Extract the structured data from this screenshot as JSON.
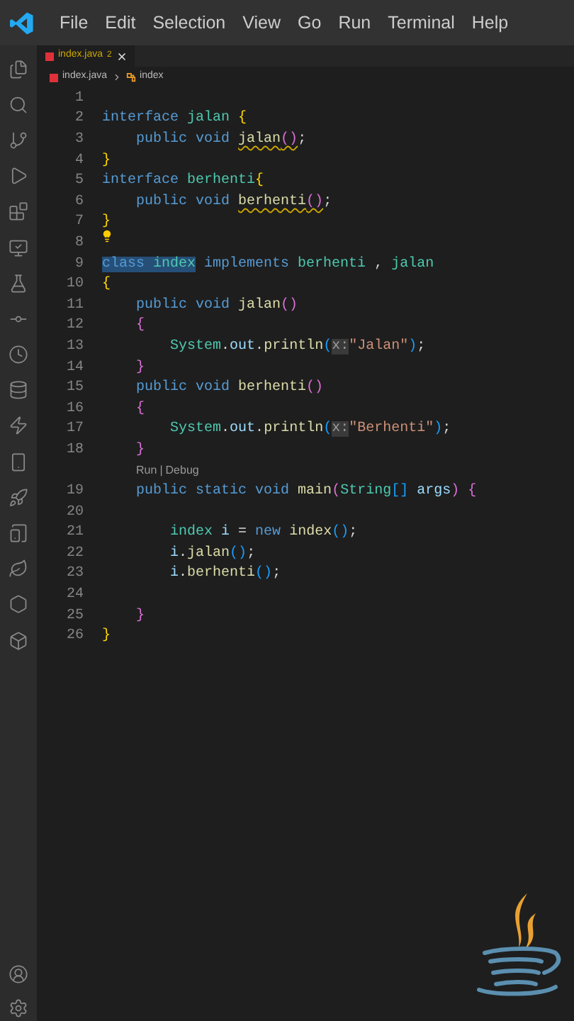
{
  "menu": [
    "File",
    "Edit",
    "Selection",
    "View",
    "Go",
    "Run",
    "Terminal",
    "Help"
  ],
  "tab": {
    "label": "index.java",
    "problems": "2",
    "selected": true
  },
  "breadcrumb": [
    "index.java",
    "index"
  ],
  "lines": [
    {
      "kind": "code",
      "number": "1",
      "lightbulb": false
    },
    {
      "kind": "code",
      "number": "2",
      "lightbulb": false,
      "tokens": [
        {
          "text": "interface",
          "kind": "kw",
          "selected": false,
          "warning": false
        },
        {
          "text": " jalan",
          "kind": "type",
          "selected": false,
          "warning": false
        },
        {
          "text": " {",
          "kind": "b1",
          "selected": false,
          "warning": false
        }
      ]
    },
    {
      "kind": "code",
      "number": "3",
      "lightbulb": false,
      "tokens": [
        {
          "text": "    public",
          "kind": "kw",
          "selected": false,
          "warning": false
        },
        {
          "text": " void ",
          "kind": "kw",
          "selected": false,
          "warning": false
        },
        {
          "text": "jalan",
          "kind": "fn",
          "selected": false,
          "warning": true
        },
        {
          "text": "()",
          "kind": "b2",
          "selected": false,
          "warning": true
        },
        {
          "text": ";",
          "kind": "punc",
          "selected": false,
          "warning": false
        }
      ]
    },
    {
      "kind": "code",
      "number": "4",
      "lightbulb": false,
      "tokens": [
        {
          "text": "}",
          "kind": "b1",
          "selected": false,
          "warning": false
        }
      ]
    },
    {
      "kind": "code",
      "number": "5",
      "lightbulb": false,
      "tokens": [
        {
          "text": "interface",
          "kind": "kw",
          "selected": false,
          "warning": false
        },
        {
          "text": " berhenti",
          "kind": "type",
          "selected": false,
          "warning": false
        },
        {
          "text": "{",
          "kind": "b1",
          "selected": false,
          "warning": false
        }
      ]
    },
    {
      "kind": "code",
      "number": "6",
      "lightbulb": false,
      "tokens": [
        {
          "text": "    public",
          "kind": "kw",
          "selected": false,
          "warning": false
        },
        {
          "text": " void ",
          "kind": "kw",
          "selected": false,
          "warning": false
        },
        {
          "text": "berhenti",
          "kind": "fn",
          "selected": false,
          "warning": true
        },
        {
          "text": "()",
          "kind": "b2",
          "selected": false,
          "warning": true
        },
        {
          "text": ";",
          "kind": "punc",
          "selected": false,
          "warning": false
        }
      ]
    },
    {
      "kind": "code",
      "number": "7",
      "lightbulb": false,
      "tokens": [
        {
          "text": "}",
          "kind": "b1",
          "selected": false,
          "warning": false
        }
      ]
    },
    {
      "kind": "code",
      "number": "8",
      "lightbulb": true
    },
    {
      "kind": "code",
      "number": "9",
      "lightbulb": false,
      "tokens": [
        {
          "text": "class",
          "kind": "kw",
          "selected": true,
          "warning": false
        },
        {
          "text": " index",
          "kind": "type",
          "selected": true,
          "warning": false
        },
        {
          "text": " implements",
          "kind": "kw",
          "selected": false,
          "warning": false
        },
        {
          "text": " berhenti",
          "kind": "type",
          "selected": false,
          "warning": false
        },
        {
          "text": " ,",
          "kind": "punc",
          "selected": false,
          "warning": false
        },
        {
          "text": " jalan",
          "kind": "type",
          "selected": false,
          "warning": false
        }
      ]
    },
    {
      "kind": "code",
      "number": "10",
      "lightbulb": false,
      "tokens": [
        {
          "text": "{",
          "kind": "b1",
          "selected": false,
          "warning": false
        }
      ]
    },
    {
      "kind": "code",
      "number": "11",
      "lightbulb": false,
      "tokens": [
        {
          "text": "    public",
          "kind": "kw",
          "selected": false,
          "warning": false
        },
        {
          "text": " void",
          "kind": "kw",
          "selected": false,
          "warning": false
        },
        {
          "text": " jalan",
          "kind": "fn",
          "selected": false,
          "warning": false
        },
        {
          "text": "()",
          "kind": "b2",
          "selected": false,
          "warning": false
        }
      ]
    },
    {
      "kind": "code",
      "number": "12",
      "lightbulb": false,
      "tokens": [
        {
          "text": "    {",
          "kind": "b2",
          "selected": false,
          "warning": false
        }
      ]
    },
    {
      "kind": "code",
      "number": "13",
      "lightbulb": false,
      "tokens": [
        {
          "text": "        System",
          "kind": "type",
          "selected": false,
          "warning": false
        },
        {
          "text": ".",
          "kind": "punc",
          "selected": false,
          "warning": false
        },
        {
          "text": "out",
          "kind": "var",
          "selected": false,
          "warning": false
        },
        {
          "text": ".",
          "kind": "punc",
          "selected": false,
          "warning": false
        },
        {
          "text": "println",
          "kind": "fn",
          "selected": false,
          "warning": false
        },
        {
          "text": "(",
          "kind": "b3",
          "selected": false,
          "warning": false
        },
        {
          "text": "x:",
          "kind": "hint",
          "selected": false,
          "warning": false
        },
        {
          "text": "\"Jalan\"",
          "kind": "str",
          "selected": false,
          "warning": false
        },
        {
          "text": ")",
          "kind": "b3",
          "selected": false,
          "warning": false
        },
        {
          "text": ";",
          "kind": "punc",
          "selected": false,
          "warning": false
        }
      ]
    },
    {
      "kind": "code",
      "number": "14",
      "lightbulb": false,
      "tokens": [
        {
          "text": "    }",
          "kind": "b2",
          "selected": false,
          "warning": false
        }
      ]
    },
    {
      "kind": "code",
      "number": "15",
      "lightbulb": false,
      "tokens": [
        {
          "text": "    public",
          "kind": "kw",
          "selected": false,
          "warning": false
        },
        {
          "text": " void",
          "kind": "kw",
          "selected": false,
          "warning": false
        },
        {
          "text": " berhenti",
          "kind": "fn",
          "selected": false,
          "warning": false
        },
        {
          "text": "()",
          "kind": "b2",
          "selected": false,
          "warning": false
        }
      ]
    },
    {
      "kind": "code",
      "number": "16",
      "lightbulb": false,
      "tokens": [
        {
          "text": "    {",
          "kind": "b2",
          "selected": false,
          "warning": false
        }
      ]
    },
    {
      "kind": "code",
      "number": "17",
      "lightbulb": false,
      "tokens": [
        {
          "text": "        System",
          "kind": "type",
          "selected": false,
          "warning": false
        },
        {
          "text": ".",
          "kind": "punc",
          "selected": false,
          "warning": false
        },
        {
          "text": "out",
          "kind": "var",
          "selected": false,
          "warning": false
        },
        {
          "text": ".",
          "kind": "punc",
          "selected": false,
          "warning": false
        },
        {
          "text": "println",
          "kind": "fn",
          "selected": false,
          "warning": false
        },
        {
          "text": "(",
          "kind": "b3",
          "selected": false,
          "warning": false
        },
        {
          "text": "x:",
          "kind": "hint",
          "selected": false,
          "warning": false
        },
        {
          "text": "\"Berhenti\"",
          "kind": "str",
          "selected": false,
          "warning": false
        },
        {
          "text": ")",
          "kind": "b3",
          "selected": false,
          "warning": false
        },
        {
          "text": ";",
          "kind": "punc",
          "selected": false,
          "warning": false
        }
      ]
    },
    {
      "kind": "code",
      "number": "18",
      "lightbulb": false,
      "tokens": [
        {
          "text": "    }",
          "kind": "b2",
          "selected": false,
          "warning": false
        }
      ]
    },
    {
      "kind": "codelens",
      "run": "Run",
      "separator": "|",
      "debug": "Debug"
    },
    {
      "kind": "code",
      "number": "19",
      "lightbulb": false,
      "tokens": [
        {
          "text": "    public",
          "kind": "kw",
          "selected": false,
          "warning": false
        },
        {
          "text": " static",
          "kind": "kw",
          "selected": false,
          "warning": false
        },
        {
          "text": " void",
          "kind": "kw",
          "selected": false,
          "warning": false
        },
        {
          "text": " main",
          "kind": "fn",
          "selected": false,
          "warning": false
        },
        {
          "text": "(",
          "kind": "b2",
          "selected": false,
          "warning": false
        },
        {
          "text": "String",
          "kind": "type",
          "selected": false,
          "warning": false
        },
        {
          "text": "[]",
          "kind": "b3",
          "selected": false,
          "warning": false
        },
        {
          "text": " args",
          "kind": "var",
          "selected": false,
          "warning": false
        },
        {
          "text": ")",
          "kind": "b2",
          "selected": false,
          "warning": false
        },
        {
          "text": " {",
          "kind": "b2",
          "selected": false,
          "warning": false
        }
      ]
    },
    {
      "kind": "code",
      "number": "20",
      "lightbulb": false
    },
    {
      "kind": "code",
      "number": "21",
      "lightbulb": false,
      "tokens": [
        {
          "text": "        index",
          "kind": "type",
          "selected": false,
          "warning": false
        },
        {
          "text": " i",
          "kind": "var",
          "selected": false,
          "warning": false
        },
        {
          "text": " =",
          "kind": "punc",
          "selected": false,
          "warning": false
        },
        {
          "text": " new",
          "kind": "kw",
          "selected": false,
          "warning": false
        },
        {
          "text": " index",
          "kind": "fn",
          "selected": false,
          "warning": false
        },
        {
          "text": "()",
          "kind": "b3",
          "selected": false,
          "warning": false
        },
        {
          "text": ";",
          "kind": "punc",
          "selected": false,
          "warning": false
        }
      ]
    },
    {
      "kind": "code",
      "number": "22",
      "lightbulb": false,
      "tokens": [
        {
          "text": "        i",
          "kind": "var",
          "selected": false,
          "warning": false
        },
        {
          "text": ".",
          "kind": "punc",
          "selected": false,
          "warning": false
        },
        {
          "text": "jalan",
          "kind": "fn",
          "selected": false,
          "warning": false
        },
        {
          "text": "()",
          "kind": "b3",
          "selected": false,
          "warning": false
        },
        {
          "text": ";",
          "kind": "punc",
          "selected": false,
          "warning": false
        }
      ]
    },
    {
      "kind": "code",
      "number": "23",
      "lightbulb": false,
      "tokens": [
        {
          "text": "        i",
          "kind": "var",
          "selected": false,
          "warning": false
        },
        {
          "text": ".",
          "kind": "punc",
          "selected": false,
          "warning": false
        },
        {
          "text": "berhenti",
          "kind": "fn",
          "selected": false,
          "warning": false
        },
        {
          "text": "()",
          "kind": "b3",
          "selected": false,
          "warning": false
        },
        {
          "text": ";",
          "kind": "punc",
          "selected": false,
          "warning": false
        }
      ]
    },
    {
      "kind": "code",
      "number": "24",
      "lightbulb": false
    },
    {
      "kind": "code",
      "number": "25",
      "lightbulb": false,
      "tokens": [
        {
          "text": "    }",
          "kind": "b2",
          "selected": false,
          "warning": false
        }
      ]
    },
    {
      "kind": "code",
      "number": "26",
      "lightbulb": false,
      "tokens": [
        {
          "text": "}",
          "kind": "b1",
          "selected": false,
          "warning": false
        }
      ]
    }
  ]
}
